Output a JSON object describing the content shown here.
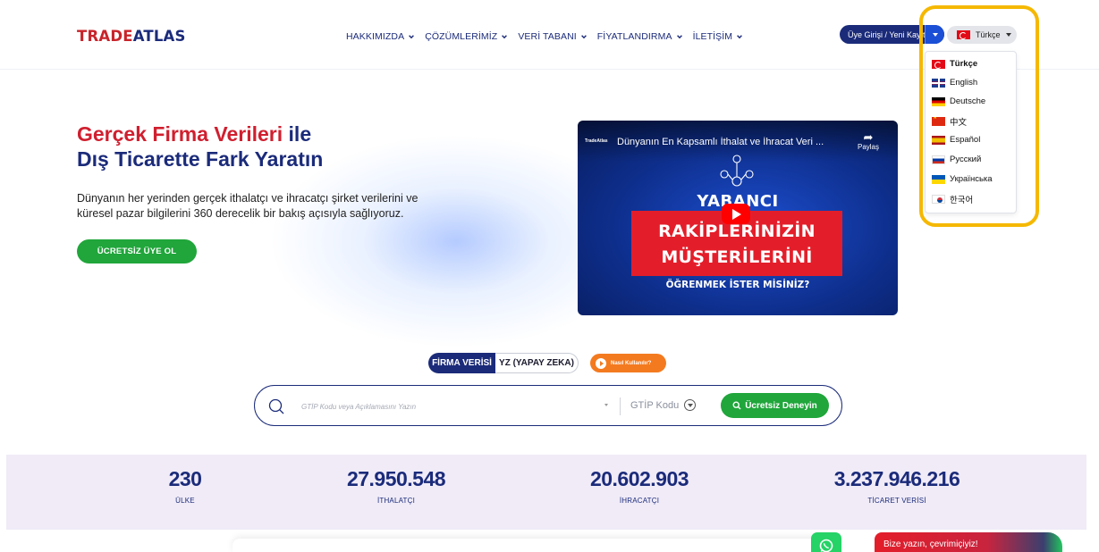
{
  "brand": {
    "logo_part1": "TRADE",
    "logo_part2": "ATLAS"
  },
  "nav": [
    {
      "label": "HAKKIMIZDA"
    },
    {
      "label": "ÇÖZÜMLERİMİZ"
    },
    {
      "label": "VERİ TABANI"
    },
    {
      "label": "FİYATLANDIRMA"
    },
    {
      "label": "İLETİŞİM"
    }
  ],
  "header": {
    "login_label": "Üye Girişi / Yeni Kayıt",
    "language_current": "Türkçe"
  },
  "language_menu": {
    "items": [
      {
        "label": "Türkçe",
        "flag": "flag-tr",
        "selected": true
      },
      {
        "label": "English",
        "flag": "flag-gb"
      },
      {
        "label": "Deutsche",
        "flag": "flag-de"
      },
      {
        "label": "中文",
        "flag": "flag-cn"
      },
      {
        "label": "Español",
        "flag": "flag-es"
      },
      {
        "label": "Русский",
        "flag": "flag-ru"
      },
      {
        "label": "Українська",
        "flag": "flag-ua"
      },
      {
        "label": "한국어",
        "flag": "flag-kr"
      }
    ],
    "highlight_color": "#f5b800"
  },
  "hero": {
    "title_red": "Gerçek Firma Verileri",
    "title_navy_1": " ile",
    "title_navy_2": "Dış Ticarette Fark Yaratın",
    "subtitle": "Dünyanın her yerinden gerçek ithalatçı ve ihracatçı şirket verilerini ve küresel pazar bilgilerini 360 derecelik bir bakış açısıyla sağlıyoruz.",
    "cta_label": "ÜCRETSİZ ÜYE OL"
  },
  "video": {
    "channel_logo": "TradeAtlas",
    "title": "Dünyanın En Kapsamlı İthalat ve İhracat Veri ...",
    "share_label": "Paylaş",
    "line_top": "YABANCI",
    "line_1": "RAKİPLERİNİZİN",
    "line_2": "MÜŞTERİLERİNİ",
    "line_bottom": "ÖĞRENMEK İSTER MİSİNİZ?"
  },
  "search": {
    "tab_firma": "FİRMA VERİSİ",
    "tab_yz": "YZ (YAPAY ZEKA)",
    "howto_label": "Nasıl Kullanılır?",
    "placeholder": "GTİP Kodu veya Açıklamasını Yazın",
    "gtip_label": "GTİP Kodu",
    "submit_label": "Ücretsiz Deneyin"
  },
  "stats": [
    {
      "value": "230",
      "label": "ÜLKE"
    },
    {
      "value": "27.950.548",
      "label": "İTHALATÇI"
    },
    {
      "value": "20.602.903",
      "label": "İHRACATÇI"
    },
    {
      "value": "3.237.946.216",
      "label": "TİCARET VERİSİ"
    }
  ],
  "chat": {
    "label": "Bize yazın, çevrimiçiyiz!"
  },
  "colors": {
    "brand_navy": "#1b2b7a",
    "brand_red": "#d01f2f",
    "cta_green": "#20a63b",
    "howto_orange": "#f47a1f"
  }
}
